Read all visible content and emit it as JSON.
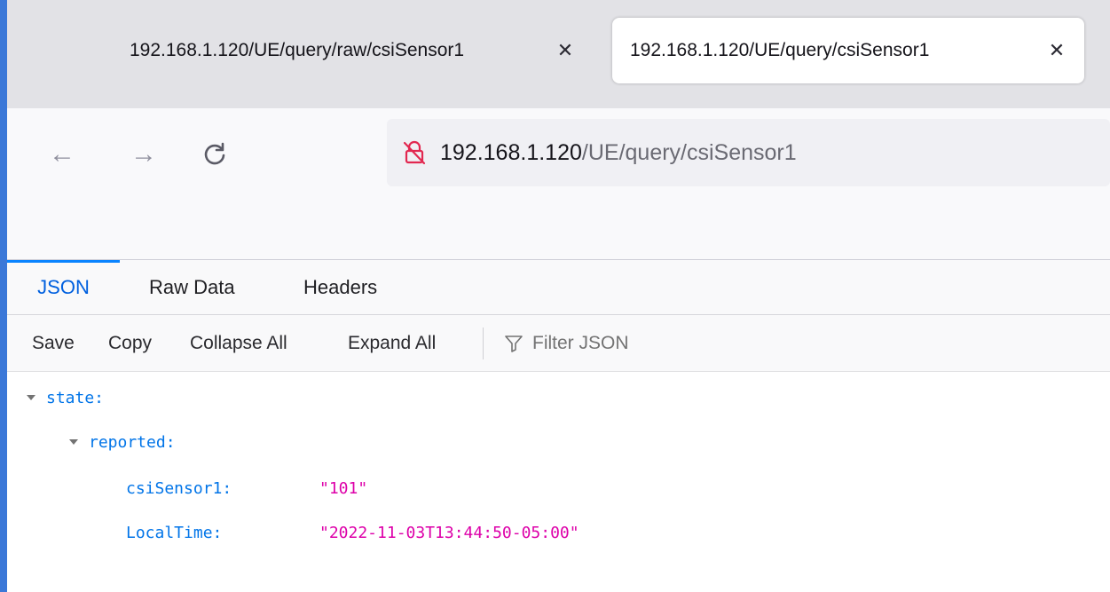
{
  "tabs": [
    {
      "title": "192.168.1.120/UE/query/raw/csiSensor1",
      "active": false,
      "close_glyph": "✕"
    },
    {
      "title": "192.168.1.120/UE/query/csiSensor1",
      "active": true,
      "close_glyph": "✕"
    }
  ],
  "navigation": {
    "back_glyph": "←",
    "forward_glyph": "→",
    "reload_glyph": "C"
  },
  "urlbar": {
    "host": "192.168.1.120",
    "path": "/UE/query/csiSensor1",
    "security_icon": "insecure-lock-icon"
  },
  "viewer_tabs": [
    {
      "label": "JSON",
      "selected": true
    },
    {
      "label": "Raw Data",
      "selected": false
    },
    {
      "label": "Headers",
      "selected": false
    }
  ],
  "actions": {
    "save": "Save",
    "copy": "Copy",
    "collapse_all": "Collapse All",
    "expand_all": "Expand All",
    "filter_placeholder": "Filter JSON"
  },
  "json_tree": {
    "state_key": "state:",
    "reported_key": "reported:",
    "entries": [
      {
        "key": "csiSensor1:",
        "value": "\"101\""
      },
      {
        "key": "LocalTime:",
        "value": "\"2022-11-03T13:44:50-05:00\""
      }
    ]
  },
  "colors": {
    "accent": "#0a84ff",
    "key": "#0074e8",
    "string_value": "#dd00a9",
    "insecure_icon": "#e22850"
  }
}
